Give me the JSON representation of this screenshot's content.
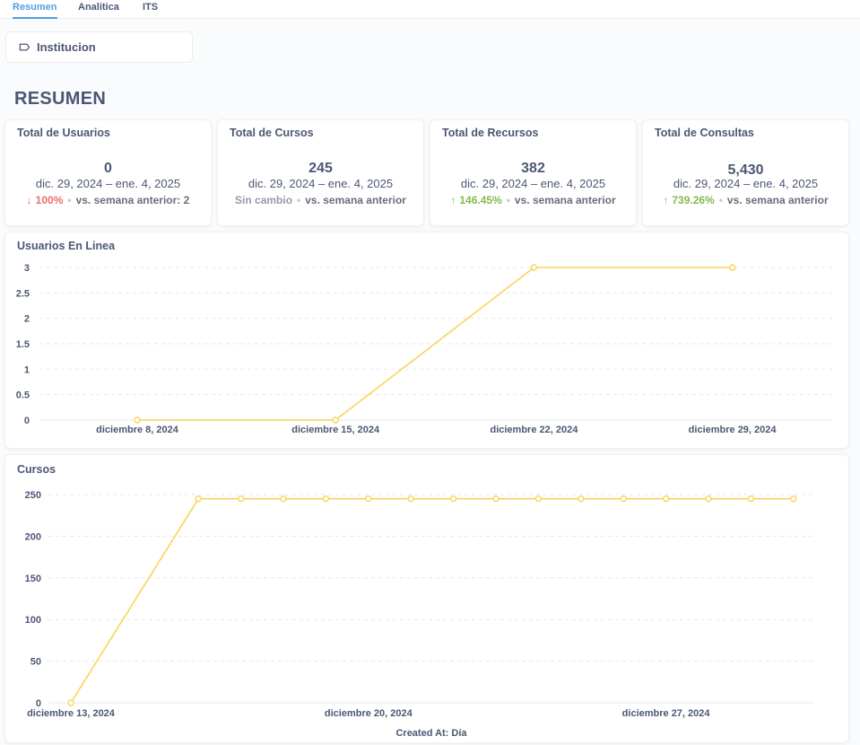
{
  "tabs": [
    {
      "label": "Resumen",
      "active": true
    },
    {
      "label": "Analitica",
      "active": false
    },
    {
      "label": "ITS",
      "active": false
    }
  ],
  "filter": {
    "label": "Institucion",
    "icon": "tag-icon"
  },
  "section_title": "RESUMEN",
  "kpis": [
    {
      "title": "Total de Usuarios",
      "value": "0",
      "range": "dic. 29, 2024 – ene. 4, 2025",
      "change": "100%",
      "direction": "down",
      "compare": "vs. semana anterior: 2"
    },
    {
      "title": "Total de Cursos",
      "value": "245",
      "range": "dic. 29, 2024 – ene. 4, 2025",
      "change": "Sin cambio",
      "direction": "none",
      "compare": "vs. semana anterior"
    },
    {
      "title": "Total de Recursos",
      "value": "382",
      "range": "dic. 29, 2024 – ene. 4, 2025",
      "change": "146.45%",
      "direction": "up",
      "compare": "vs. semana anterior"
    },
    {
      "title": "Total de Consultas",
      "value": "5,430",
      "range": "dic. 29, 2024 – ene. 4, 2025",
      "change": "739.26%",
      "direction": "up",
      "compare": "vs. semana anterior"
    }
  ],
  "colors": {
    "series": "#f9d45c",
    "up": "#84bb4c",
    "down": "#ed6e6e",
    "neutral": "#949aab",
    "accent": "#509ee3"
  },
  "chart_data": [
    {
      "type": "line",
      "title": "Usuarios En Linea",
      "x": [
        "2024-12-08",
        "2024-12-15",
        "2024-12-22",
        "2024-12-29"
      ],
      "x_tick_labels": [
        "diciembre 8, 2024",
        "diciembre 15, 2024",
        "diciembre 22, 2024",
        "diciembre 29, 2024"
      ],
      "series": [
        {
          "values": [
            0,
            0,
            3,
            3
          ]
        }
      ],
      "y_ticks": [
        "0",
        "0.5",
        "1",
        "1.5",
        "2",
        "2.5",
        "3"
      ],
      "ylim": [
        0,
        3
      ],
      "xlabel": "",
      "ylabel": "",
      "grid": true
    },
    {
      "type": "line",
      "title": "Cursos",
      "x": [
        "2024-12-13",
        "2024-12-16",
        "2024-12-17",
        "2024-12-18",
        "2024-12-19",
        "2024-12-20",
        "2024-12-21",
        "2024-12-22",
        "2024-12-23",
        "2024-12-24",
        "2024-12-25",
        "2024-12-26",
        "2024-12-27",
        "2024-12-28",
        "2024-12-29",
        "2024-12-30"
      ],
      "x_tick_labels": [
        {
          "date": "2024-12-13",
          "label": "diciembre 13, 2024"
        },
        {
          "date": "2024-12-20",
          "label": "diciembre 20, 2024"
        },
        {
          "date": "2024-12-27",
          "label": "diciembre 27, 2024"
        }
      ],
      "series": [
        {
          "values": [
            0,
            245,
            245,
            245,
            245,
            245,
            245,
            245,
            245,
            245,
            245,
            245,
            245,
            245,
            245,
            245
          ]
        }
      ],
      "y_ticks": [
        "0",
        "50",
        "100",
        "150",
        "200",
        "250"
      ],
      "ylim": [
        0,
        250
      ],
      "xlabel": "Created At: Día",
      "ylabel": "",
      "grid": true
    }
  ]
}
